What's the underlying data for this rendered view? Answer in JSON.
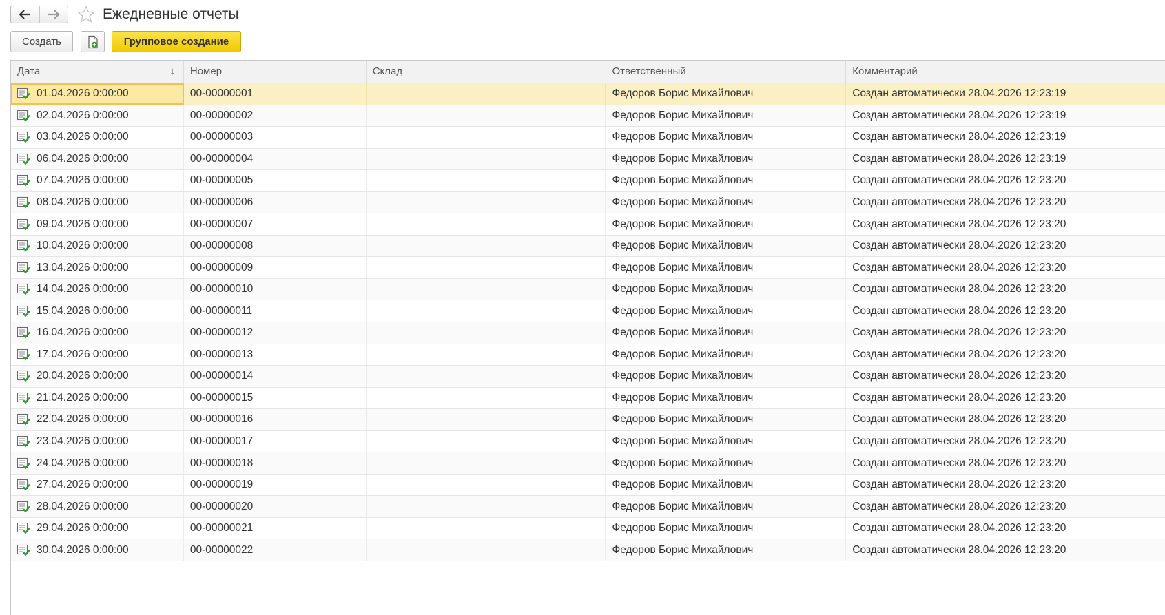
{
  "window": {
    "title": "Ежедневные отчеты"
  },
  "toolbar": {
    "create_label": "Создать",
    "group_create_label": "Групповое создание"
  },
  "colors": {
    "accent_button": "#f4d00f",
    "selected_row": "#fbf0c4",
    "doc_icon_check": "#2e9b2e"
  },
  "table": {
    "columns": [
      "Дата",
      "Номер",
      "Склад",
      "Ответственный",
      "Комментарий"
    ],
    "sort_indicator": "↓",
    "rows": [
      {
        "date": "01.04.2026 0:00:00",
        "number": "00-00000001",
        "warehouse": "",
        "responsible": "Федоров Борис Михайлович",
        "comment": "Создан автоматически 28.04.2026 12:23:19"
      },
      {
        "date": "02.04.2026 0:00:00",
        "number": "00-00000002",
        "warehouse": "",
        "responsible": "Федоров Борис Михайлович",
        "comment": "Создан автоматически 28.04.2026 12:23:19"
      },
      {
        "date": "03.04.2026 0:00:00",
        "number": "00-00000003",
        "warehouse": "",
        "responsible": "Федоров Борис Михайлович",
        "comment": "Создан автоматически 28.04.2026 12:23:19"
      },
      {
        "date": "06.04.2026 0:00:00",
        "number": "00-00000004",
        "warehouse": "",
        "responsible": "Федоров Борис Михайлович",
        "comment": "Создан автоматически 28.04.2026 12:23:19"
      },
      {
        "date": "07.04.2026 0:00:00",
        "number": "00-00000005",
        "warehouse": "",
        "responsible": "Федоров Борис Михайлович",
        "comment": "Создан автоматически 28.04.2026 12:23:20"
      },
      {
        "date": "08.04.2026 0:00:00",
        "number": "00-00000006",
        "warehouse": "",
        "responsible": "Федоров Борис Михайлович",
        "comment": "Создан автоматически 28.04.2026 12:23:20"
      },
      {
        "date": "09.04.2026 0:00:00",
        "number": "00-00000007",
        "warehouse": "",
        "responsible": "Федоров Борис Михайлович",
        "comment": "Создан автоматически 28.04.2026 12:23:20"
      },
      {
        "date": "10.04.2026 0:00:00",
        "number": "00-00000008",
        "warehouse": "",
        "responsible": "Федоров Борис Михайлович",
        "comment": "Создан автоматически 28.04.2026 12:23:20"
      },
      {
        "date": "13.04.2026 0:00:00",
        "number": "00-00000009",
        "warehouse": "",
        "responsible": "Федоров Борис Михайлович",
        "comment": "Создан автоматически 28.04.2026 12:23:20"
      },
      {
        "date": "14.04.2026 0:00:00",
        "number": "00-00000010",
        "warehouse": "",
        "responsible": "Федоров Борис Михайлович",
        "comment": "Создан автоматически 28.04.2026 12:23:20"
      },
      {
        "date": "15.04.2026 0:00:00",
        "number": "00-00000011",
        "warehouse": "",
        "responsible": "Федоров Борис Михайлович",
        "comment": "Создан автоматически 28.04.2026 12:23:20"
      },
      {
        "date": "16.04.2026 0:00:00",
        "number": "00-00000012",
        "warehouse": "",
        "responsible": "Федоров Борис Михайлович",
        "comment": "Создан автоматически 28.04.2026 12:23:20"
      },
      {
        "date": "17.04.2026 0:00:00",
        "number": "00-00000013",
        "warehouse": "",
        "responsible": "Федоров Борис Михайлович",
        "comment": "Создан автоматически 28.04.2026 12:23:20"
      },
      {
        "date": "20.04.2026 0:00:00",
        "number": "00-00000014",
        "warehouse": "",
        "responsible": "Федоров Борис Михайлович",
        "comment": "Создан автоматически 28.04.2026 12:23:20"
      },
      {
        "date": "21.04.2026 0:00:00",
        "number": "00-00000015",
        "warehouse": "",
        "responsible": "Федоров Борис Михайлович",
        "comment": "Создан автоматически 28.04.2026 12:23:20"
      },
      {
        "date": "22.04.2026 0:00:00",
        "number": "00-00000016",
        "warehouse": "",
        "responsible": "Федоров Борис Михайлович",
        "comment": "Создан автоматически 28.04.2026 12:23:20"
      },
      {
        "date": "23.04.2026 0:00:00",
        "number": "00-00000017",
        "warehouse": "",
        "responsible": "Федоров Борис Михайлович",
        "comment": "Создан автоматически 28.04.2026 12:23:20"
      },
      {
        "date": "24.04.2026 0:00:00",
        "number": "00-00000018",
        "warehouse": "",
        "responsible": "Федоров Борис Михайлович",
        "comment": "Создан автоматически 28.04.2026 12:23:20"
      },
      {
        "date": "27.04.2026 0:00:00",
        "number": "00-00000019",
        "warehouse": "",
        "responsible": "Федоров Борис Михайлович",
        "comment": "Создан автоматически 28.04.2026 12:23:20"
      },
      {
        "date": "28.04.2026 0:00:00",
        "number": "00-00000020",
        "warehouse": "",
        "responsible": "Федоров Борис Михайлович",
        "comment": "Создан автоматически 28.04.2026 12:23:20"
      },
      {
        "date": "29.04.2026 0:00:00",
        "number": "00-00000021",
        "warehouse": "",
        "responsible": "Федоров Борис Михайлович",
        "comment": "Создан автоматически 28.04.2026 12:23:20"
      },
      {
        "date": "30.04.2026 0:00:00",
        "number": "00-00000022",
        "warehouse": "",
        "responsible": "Федоров Борис Михайлович",
        "comment": "Создан автоматически 28.04.2026 12:23:20"
      }
    ]
  }
}
